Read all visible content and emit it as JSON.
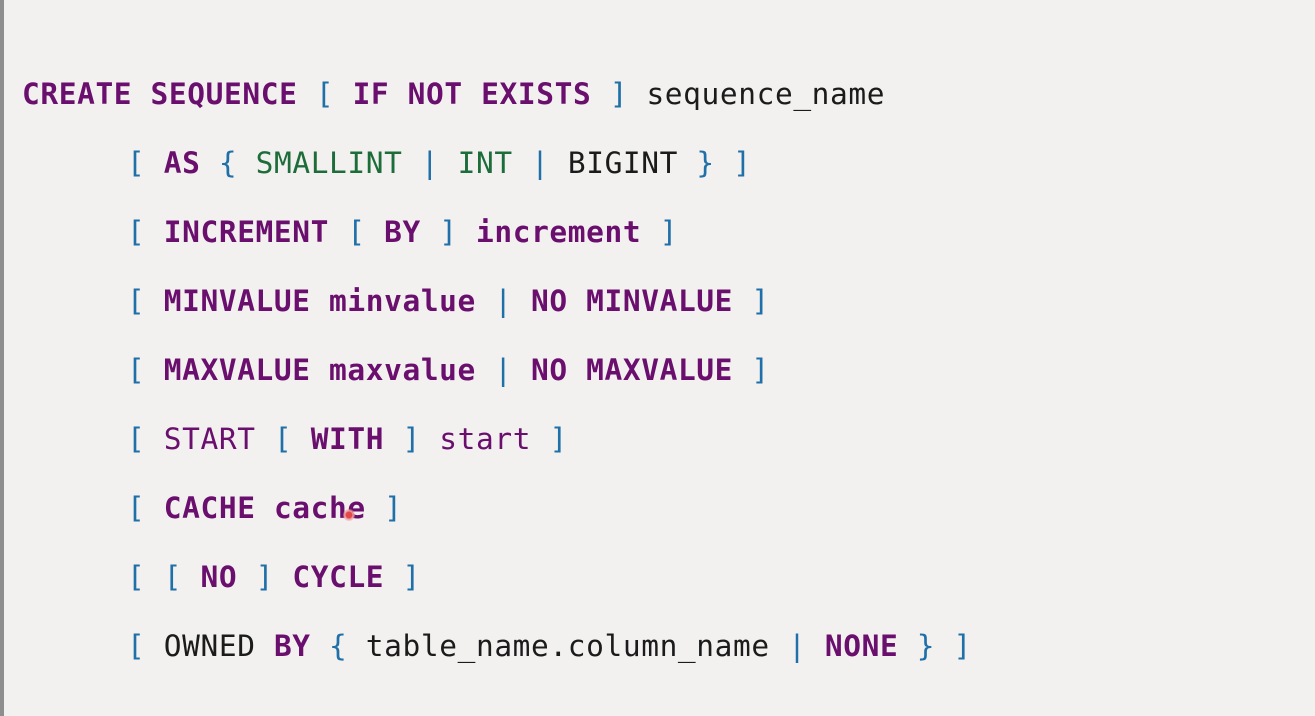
{
  "lines": [
    [
      {
        "t": "CREATE",
        "c": "kw"
      },
      {
        "t": " "
      },
      {
        "t": "SEQUENCE",
        "c": "kw"
      },
      {
        "t": " "
      },
      {
        "t": "[",
        "c": "punc"
      },
      {
        "t": " "
      },
      {
        "t": "IF",
        "c": "kw"
      },
      {
        "t": " "
      },
      {
        "t": "NOT",
        "c": "kw"
      },
      {
        "t": " "
      },
      {
        "t": "EXISTS",
        "c": "kw"
      },
      {
        "t": " "
      },
      {
        "t": "]",
        "c": "punc"
      },
      {
        "t": " "
      },
      {
        "t": "sequence_name",
        "c": "ident"
      }
    ],
    [
      {
        "t": "[",
        "c": "punc"
      },
      {
        "t": " "
      },
      {
        "t": "AS",
        "c": "kw"
      },
      {
        "t": " "
      },
      {
        "t": "{",
        "c": "punc"
      },
      {
        "t": " "
      },
      {
        "t": "SMALLINT",
        "c": "type"
      },
      {
        "t": " "
      },
      {
        "t": "|",
        "c": "punc"
      },
      {
        "t": " "
      },
      {
        "t": "INT",
        "c": "type"
      },
      {
        "t": " "
      },
      {
        "t": "|",
        "c": "punc"
      },
      {
        "t": " "
      },
      {
        "t": "BIGINT",
        "c": "ident"
      },
      {
        "t": " "
      },
      {
        "t": "}",
        "c": "punc"
      },
      {
        "t": " "
      },
      {
        "t": "]",
        "c": "punc"
      }
    ],
    [
      {
        "t": "[",
        "c": "punc"
      },
      {
        "t": " "
      },
      {
        "t": "INCREMENT",
        "c": "kw"
      },
      {
        "t": " "
      },
      {
        "t": "[",
        "c": "punc"
      },
      {
        "t": " "
      },
      {
        "t": "BY",
        "c": "kw"
      },
      {
        "t": " "
      },
      {
        "t": "]",
        "c": "punc"
      },
      {
        "t": " "
      },
      {
        "t": "increment",
        "c": "param"
      },
      {
        "t": " "
      },
      {
        "t": "]",
        "c": "punc"
      }
    ],
    [
      {
        "t": "[",
        "c": "punc"
      },
      {
        "t": " "
      },
      {
        "t": "MINVALUE",
        "c": "kw"
      },
      {
        "t": " "
      },
      {
        "t": "minvalue",
        "c": "param"
      },
      {
        "t": " "
      },
      {
        "t": "|",
        "c": "punc"
      },
      {
        "t": " "
      },
      {
        "t": "NO",
        "c": "kw"
      },
      {
        "t": " "
      },
      {
        "t": "MINVALUE",
        "c": "kw"
      },
      {
        "t": " "
      },
      {
        "t": "]",
        "c": "punc"
      }
    ],
    [
      {
        "t": "[",
        "c": "punc"
      },
      {
        "t": " "
      },
      {
        "t": "MAXVALUE",
        "c": "kw"
      },
      {
        "t": " "
      },
      {
        "t": "maxvalue",
        "c": "param"
      },
      {
        "t": " "
      },
      {
        "t": "|",
        "c": "punc"
      },
      {
        "t": " "
      },
      {
        "t": "NO",
        "c": "kw"
      },
      {
        "t": " "
      },
      {
        "t": "MAXVALUE",
        "c": "kw"
      },
      {
        "t": " "
      },
      {
        "t": "]",
        "c": "punc"
      }
    ],
    [
      {
        "t": "[",
        "c": "punc"
      },
      {
        "t": " "
      },
      {
        "t": "START",
        "c": "plain"
      },
      {
        "t": " "
      },
      {
        "t": "[",
        "c": "punc"
      },
      {
        "t": " "
      },
      {
        "t": "WITH",
        "c": "kw"
      },
      {
        "t": " "
      },
      {
        "t": "]",
        "c": "punc"
      },
      {
        "t": " "
      },
      {
        "t": "start",
        "c": "plain"
      },
      {
        "t": " "
      },
      {
        "t": "]",
        "c": "punc"
      }
    ],
    [
      {
        "t": "[",
        "c": "punc"
      },
      {
        "t": " "
      },
      {
        "t": "CACHE",
        "c": "kw"
      },
      {
        "t": " "
      },
      {
        "t": "cache",
        "c": "param"
      },
      {
        "t": " "
      },
      {
        "t": "]",
        "c": "punc"
      }
    ],
    [
      {
        "t": "[",
        "c": "punc"
      },
      {
        "t": " "
      },
      {
        "t": "[",
        "c": "punc"
      },
      {
        "t": " "
      },
      {
        "t": "NO",
        "c": "kw"
      },
      {
        "t": " "
      },
      {
        "t": "]",
        "c": "punc"
      },
      {
        "t": " "
      },
      {
        "t": "CYCLE",
        "c": "kw"
      },
      {
        "t": " "
      },
      {
        "t": "]",
        "c": "punc"
      }
    ],
    [
      {
        "t": "[",
        "c": "punc"
      },
      {
        "t": " "
      },
      {
        "t": "OWNED",
        "c": "ident"
      },
      {
        "t": " "
      },
      {
        "t": "BY",
        "c": "kw"
      },
      {
        "t": " "
      },
      {
        "t": "{",
        "c": "punc"
      },
      {
        "t": " "
      },
      {
        "t": "table_name.column_name",
        "c": "ident"
      },
      {
        "t": " "
      },
      {
        "t": "|",
        "c": "punc"
      },
      {
        "t": " "
      },
      {
        "t": "NONE",
        "c": "kw"
      },
      {
        "t": " "
      },
      {
        "t": "}",
        "c": "punc"
      },
      {
        "t": " "
      },
      {
        "t": "]",
        "c": "punc"
      }
    ]
  ],
  "colors": {
    "keyword": "#6a0f6e",
    "punctuation": "#1f6fa8",
    "type": "#1d6d3a",
    "identifier": "#1b1b1b",
    "background": "#f2f1ef"
  },
  "icons": {
    "pointer": "mouse-pointer-dot-icon"
  }
}
